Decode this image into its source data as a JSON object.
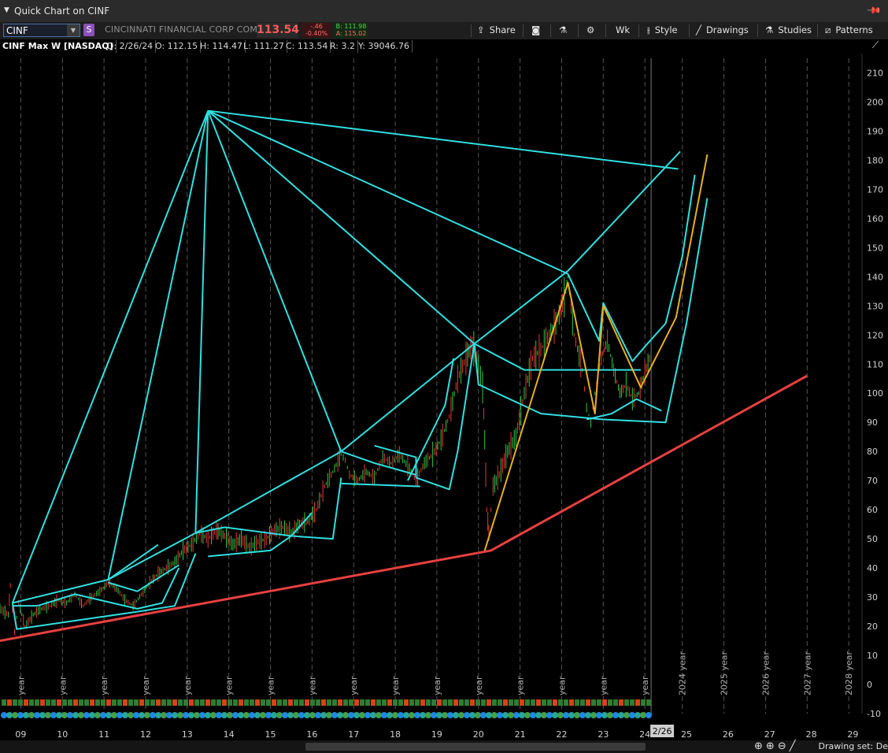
{
  "window": {
    "title": "Quick Chart on CINF"
  },
  "toolbar": {
    "symbol": "CINF",
    "symbol_badge": "S",
    "company": "CINCINNATI FINANCIAL CORP COM",
    "last": "113.54",
    "change": "-.46",
    "change_pct": "-0.40%",
    "bid": "B: 111.98",
    "ask": "A: 115.02",
    "buttons": {
      "share": "Share",
      "timeframe": "Wk",
      "style": "Style",
      "drawings": "Drawings",
      "studies": "Studies",
      "patterns": "Patterns"
    }
  },
  "status": {
    "instrument": "CINF Max W [NASDAQ]",
    "date": "D: 2/26/24",
    "open": "O: 112.15",
    "high": "H: 114.47",
    "low": "L: 111.27",
    "close": "C: 113.54",
    "range": "R: 3.2",
    "volume": "Y: 39046.76"
  },
  "chart_data": {
    "type": "line",
    "title": "CINF Max W [NASDAQ]",
    "xlabel": "",
    "ylabel": "",
    "ylim": [
      -10,
      215
    ],
    "xlim": [
      2008.5,
      2029.2
    ],
    "y_ticks": [
      210,
      200,
      190,
      180,
      170,
      160,
      150,
      140,
      130,
      120,
      110,
      100,
      90,
      80,
      70,
      60,
      50,
      40,
      30,
      20,
      10,
      0,
      -10
    ],
    "x_ticks": [
      {
        "x": 2009,
        "label": "09"
      },
      {
        "x": 2010,
        "label": "10"
      },
      {
        "x": 2011,
        "label": "11"
      },
      {
        "x": 2012,
        "label": "12"
      },
      {
        "x": 2013,
        "label": "13"
      },
      {
        "x": 2014,
        "label": "14"
      },
      {
        "x": 2015,
        "label": "15"
      },
      {
        "x": 2016,
        "label": "16"
      },
      {
        "x": 2017,
        "label": "17"
      },
      {
        "x": 2018,
        "label": "18"
      },
      {
        "x": 2019,
        "label": "19"
      },
      {
        "x": 2020,
        "label": "20"
      },
      {
        "x": 2021,
        "label": "21"
      },
      {
        "x": 2022,
        "label": "22"
      },
      {
        "x": 2023,
        "label": "23"
      },
      {
        "x": 2024,
        "label": "24"
      },
      {
        "x": 2025,
        "label": "25"
      },
      {
        "x": 2026,
        "label": "26"
      },
      {
        "x": 2027,
        "label": "27"
      },
      {
        "x": 2028,
        "label": "28"
      },
      {
        "x": 2029,
        "label": "29"
      }
    ],
    "year_markers": [
      {
        "x": 2009,
        "label": "year"
      },
      {
        "x": 2010,
        "label": "year"
      },
      {
        "x": 2011,
        "label": "year"
      },
      {
        "x": 2012,
        "label": "year"
      },
      {
        "x": 2013,
        "label": "year"
      },
      {
        "x": 2014,
        "label": "year"
      },
      {
        "x": 2015,
        "label": "year"
      },
      {
        "x": 2016,
        "label": "year"
      },
      {
        "x": 2017,
        "label": "year"
      },
      {
        "x": 2018,
        "label": "year"
      },
      {
        "x": 2019,
        "label": "year"
      },
      {
        "x": 2020,
        "label": "year"
      },
      {
        "x": 2021,
        "label": "year"
      },
      {
        "x": 2022,
        "label": "year"
      },
      {
        "x": 2023,
        "label": "year"
      },
      {
        "x": 2024,
        "label": "year"
      },
      {
        "x": 2024.9,
        "label": "2024 year"
      },
      {
        "x": 2025.9,
        "label": "2025 year"
      },
      {
        "x": 2026.9,
        "label": "2026 year"
      },
      {
        "x": 2027.9,
        "label": "2027 year"
      },
      {
        "x": 2028.9,
        "label": "2028 year"
      }
    ],
    "current_date_label": "2/26",
    "current_x": 2024.15,
    "price_series": [
      [
        2008.5,
        26
      ],
      [
        2008.7,
        24
      ],
      [
        2008.75,
        34
      ],
      [
        2008.85,
        18
      ],
      [
        2008.95,
        28
      ],
      [
        2009.1,
        20
      ],
      [
        2009.3,
        24
      ],
      [
        2009.5,
        26
      ],
      [
        2009.7,
        27
      ],
      [
        2009.9,
        29
      ],
      [
        2010.1,
        28
      ],
      [
        2010.3,
        31
      ],
      [
        2010.5,
        27
      ],
      [
        2010.7,
        30
      ],
      [
        2010.9,
        32
      ],
      [
        2011.1,
        35
      ],
      [
        2011.3,
        33
      ],
      [
        2011.5,
        29
      ],
      [
        2011.7,
        27
      ],
      [
        2011.9,
        31
      ],
      [
        2012.1,
        35
      ],
      [
        2012.3,
        38
      ],
      [
        2012.5,
        40
      ],
      [
        2012.7,
        42
      ],
      [
        2012.9,
        46
      ],
      [
        2013.1,
        48
      ],
      [
        2013.3,
        52
      ],
      [
        2013.5,
        50
      ],
      [
        2013.7,
        53
      ],
      [
        2013.9,
        51
      ],
      [
        2014.1,
        48
      ],
      [
        2014.3,
        50
      ],
      [
        2014.5,
        47
      ],
      [
        2014.7,
        49
      ],
      [
        2014.9,
        50
      ],
      [
        2015.1,
        53
      ],
      [
        2015.3,
        54
      ],
      [
        2015.5,
        52
      ],
      [
        2015.7,
        55
      ],
      [
        2015.9,
        56
      ],
      [
        2016.1,
        60
      ],
      [
        2016.3,
        68
      ],
      [
        2016.5,
        73
      ],
      [
        2016.7,
        79
      ],
      [
        2016.8,
        77
      ],
      [
        2016.9,
        72
      ],
      [
        2017.1,
        70
      ],
      [
        2017.3,
        73
      ],
      [
        2017.5,
        71
      ],
      [
        2017.7,
        78
      ],
      [
        2017.9,
        76
      ],
      [
        2018.1,
        79
      ],
      [
        2018.3,
        75
      ],
      [
        2018.5,
        70
      ],
      [
        2018.7,
        76
      ],
      [
        2018.9,
        79
      ],
      [
        2019.1,
        84
      ],
      [
        2019.3,
        92
      ],
      [
        2019.5,
        105
      ],
      [
        2019.7,
        112
      ],
      [
        2019.85,
        117
      ],
      [
        2020.0,
        110
      ],
      [
        2020.1,
        102
      ],
      [
        2020.15,
        84
      ],
      [
        2020.2,
        60
      ],
      [
        2020.25,
        52
      ],
      [
        2020.35,
        68
      ],
      [
        2020.5,
        72
      ],
      [
        2020.7,
        80
      ],
      [
        2020.9,
        85
      ],
      [
        2021.1,
        100
      ],
      [
        2021.3,
        112
      ],
      [
        2021.5,
        115
      ],
      [
        2021.7,
        120
      ],
      [
        2021.9,
        125
      ],
      [
        2022.1,
        135
      ],
      [
        2022.15,
        140
      ],
      [
        2022.3,
        120
      ],
      [
        2022.5,
        108
      ],
      [
        2022.6,
        95
      ],
      [
        2022.7,
        90
      ],
      [
        2022.8,
        100
      ],
      [
        2022.95,
        112
      ],
      [
        2023.1,
        118
      ],
      [
        2023.25,
        108
      ],
      [
        2023.4,
        100
      ],
      [
        2023.55,
        103
      ],
      [
        2023.7,
        98
      ],
      [
        2023.85,
        100
      ],
      [
        2024.0,
        107
      ],
      [
        2024.15,
        113.5
      ]
    ],
    "support_line": [
      [
        2008.5,
        15
      ],
      [
        2020.3,
        46
      ],
      [
        2027.9,
        106
      ]
    ],
    "pattern_lines": [
      [
        [
          2013.5,
          197
        ],
        [
          2024.8,
          177
        ]
      ],
      [
        [
          2013.5,
          197
        ],
        [
          2022.15,
          141
        ]
      ],
      [
        [
          2013.5,
          197
        ],
        [
          2019.9,
          117
        ]
      ],
      [
        [
          2013.5,
          197
        ],
        [
          2016.7,
          80
        ]
      ],
      [
        [
          2013.5,
          197
        ],
        [
          2013.2,
          52
        ]
      ],
      [
        [
          2013.5,
          197
        ],
        [
          2011.1,
          36
        ]
      ],
      [
        [
          2013.5,
          197
        ],
        [
          2008.8,
          28
        ]
      ],
      [
        [
          2011.1,
          36
        ],
        [
          2012.3,
          48
        ]
      ],
      [
        [
          2008.8,
          28
        ],
        [
          2011.1,
          36
        ],
        [
          2013.2,
          52
        ],
        [
          2016.7,
          80
        ],
        [
          2019.9,
          117
        ],
        [
          2022.15,
          142
        ],
        [
          2024.85,
          183
        ]
      ],
      [
        [
          2008.8,
          27
        ],
        [
          2009.4,
          27
        ],
        [
          2010.3,
          31
        ],
        [
          2011.8,
          26
        ],
        [
          2012.4,
          28
        ],
        [
          2012.8,
          40
        ]
      ],
      [
        [
          2008.8,
          28
        ],
        [
          2008.9,
          19
        ],
        [
          2011.8,
          25
        ]
      ],
      [
        [
          2011.1,
          35
        ],
        [
          2011.8,
          32
        ],
        [
          2012.8,
          41
        ]
      ],
      [
        [
          2011.8,
          25
        ],
        [
          2012.7,
          27
        ],
        [
          2013.2,
          45
        ]
      ],
      [
        [
          2013.2,
          52
        ],
        [
          2013.9,
          54
        ],
        [
          2015.5,
          51
        ],
        [
          2016.0,
          59
        ]
      ],
      [
        [
          2013.5,
          44
        ],
        [
          2015.0,
          46
        ],
        [
          2015.5,
          51
        ]
      ],
      [
        [
          2015.5,
          51
        ],
        [
          2016.5,
          50
        ],
        [
          2016.7,
          71
        ]
      ],
      [
        [
          2016.7,
          80
        ],
        [
          2017.5,
          76
        ],
        [
          2018.5,
          72
        ]
      ],
      [
        [
          2016.7,
          69
        ],
        [
          2018.6,
          68
        ]
      ],
      [
        [
          2017.5,
          82
        ],
        [
          2018.5,
          78
        ],
        [
          2018.5,
          71
        ]
      ],
      [
        [
          2018.5,
          71
        ],
        [
          2019.3,
          67
        ],
        [
          2019.5,
          80
        ],
        [
          2019.9,
          117
        ]
      ],
      [
        [
          2018.3,
          70
        ],
        [
          2019.2,
          96
        ],
        [
          2019.4,
          112
        ]
      ],
      [
        [
          2019.9,
          117
        ],
        [
          2021.1,
          108
        ],
        [
          2022.15,
          108
        ],
        [
          2023.9,
          108
        ]
      ],
      [
        [
          2019.9,
          117
        ],
        [
          2020.0,
          103
        ],
        [
          2021.5,
          93
        ],
        [
          2023.0,
          91
        ],
        [
          2024.5,
          90
        ],
        [
          2025.0,
          124
        ],
        [
          2025.5,
          167
        ]
      ],
      [
        [
          2022.15,
          141
        ],
        [
          2022.9,
          118
        ],
        [
          2023.0,
          131
        ],
        [
          2023.7,
          111
        ],
        [
          2024.0,
          116
        ],
        [
          2024.5,
          124
        ],
        [
          2024.9,
          147
        ],
        [
          2025.2,
          175
        ]
      ],
      [
        [
          2022.6,
          91
        ],
        [
          2023.2,
          93
        ],
        [
          2023.8,
          98
        ],
        [
          2024.4,
          94
        ]
      ]
    ],
    "projection_lines": [
      [
        [
          2020.15,
          46
        ],
        [
          2022.15,
          138
        ],
        [
          2022.8,
          93
        ],
        [
          2023.0,
          130
        ],
        [
          2023.9,
          102
        ],
        [
          2024.75,
          126
        ],
        [
          2025.5,
          182
        ]
      ]
    ]
  },
  "footer": {
    "drawing_set": "Drawing set: De"
  },
  "colors": {
    "price_up": "#2ecc40",
    "price_down": "#e53935",
    "pattern": "#30e0e0",
    "projection": "#e8b020",
    "support": "#e84040",
    "grid": "#555555",
    "background": "#000000"
  }
}
